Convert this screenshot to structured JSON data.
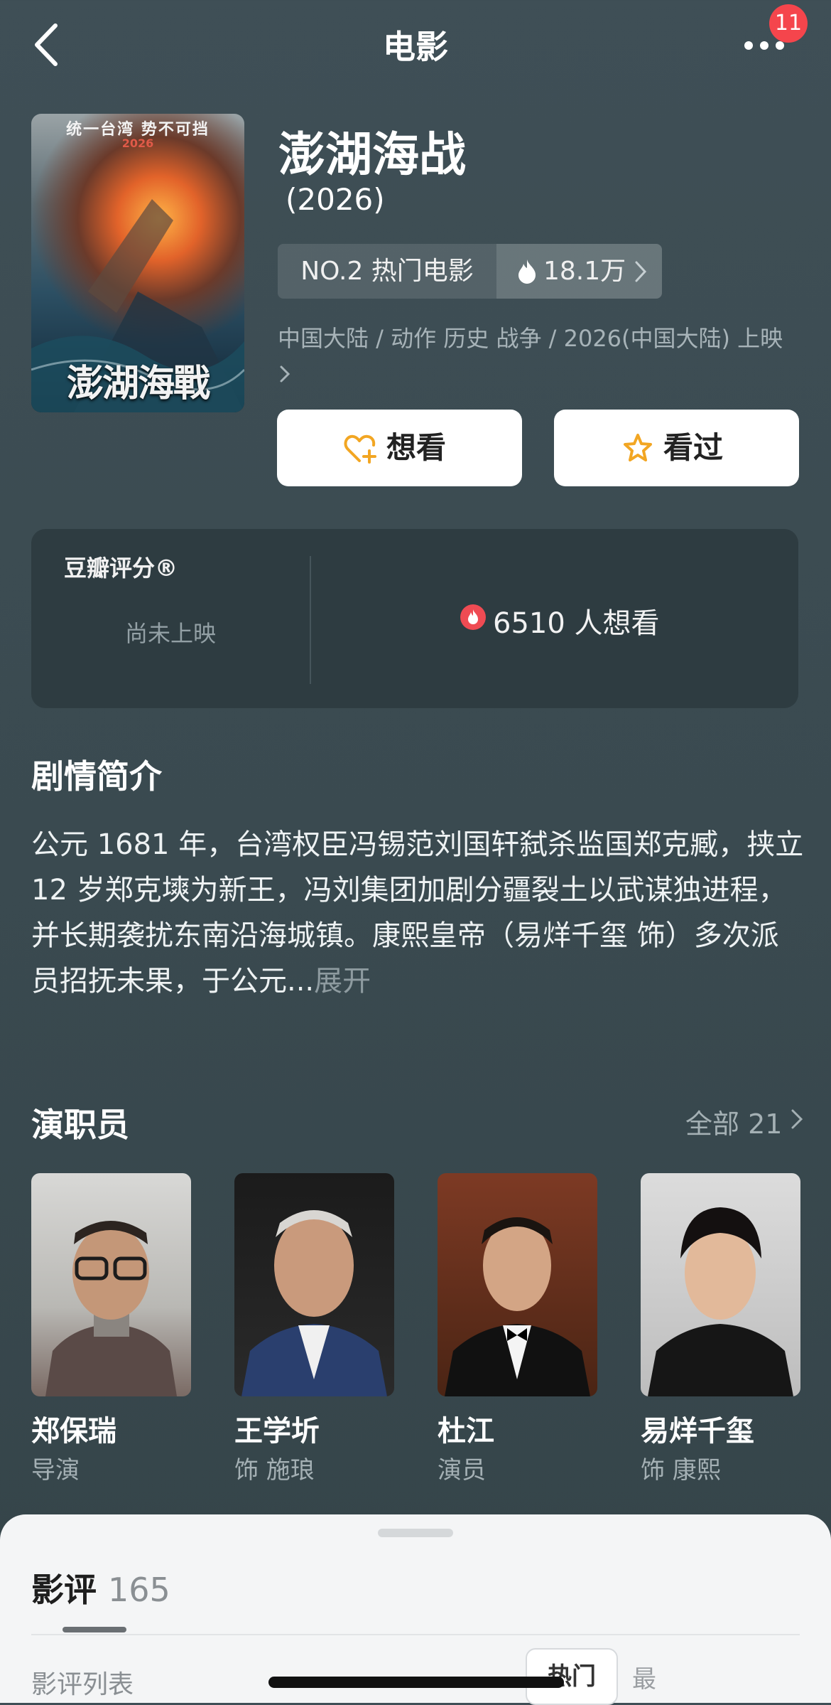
{
  "header": {
    "title": "电影",
    "notification_count": "11"
  },
  "movie": {
    "poster_top_text": "统一台湾 势不可挡",
    "poster_year": "2026",
    "poster_title": "澎湖海戰",
    "title": "澎湖海战",
    "year": "(2026)",
    "rank_label": "NO.2 热门电影",
    "heat": "18.1万",
    "meta": "中国大陆 / 动作 历史 战争 / 2026(中国大陆) 上映"
  },
  "actions": {
    "want_label": "想看",
    "watched_label": "看过"
  },
  "rating": {
    "label": "豆瓣评分®",
    "status": "尚未上映",
    "wish_count": "6510 人想看"
  },
  "synopsis": {
    "title": "剧情简介",
    "text": "公元 1681 年，台湾权臣冯锡范刘国轩弑杀监国郑克臧，挟立 12 岁郑克塽为新王，冯刘集团加剧分疆裂土以武谋独进程，并长期袭扰东南沿海城镇。康熙皇帝（易烊千玺 饰）多次派员招抚未果，于公元...",
    "expand_label": "展开"
  },
  "cast": {
    "title": "演职员",
    "all_label": "全部 21",
    "members": [
      {
        "name": "郑保瑞",
        "role": "导演"
      },
      {
        "name": "王学圻",
        "role": "饰 施琅"
      },
      {
        "name": "杜江",
        "role": "演员"
      },
      {
        "name": "易烊千玺",
        "role": "饰 康熙"
      }
    ]
  },
  "reviews": {
    "title": "影评",
    "count": "165",
    "list_label": "影评列表",
    "hot_label": "热门",
    "new_label": "最"
  },
  "colors": {
    "background": "#3d4d54",
    "accent_orange": "#f2a623",
    "fire_red": "#ef4b53"
  }
}
